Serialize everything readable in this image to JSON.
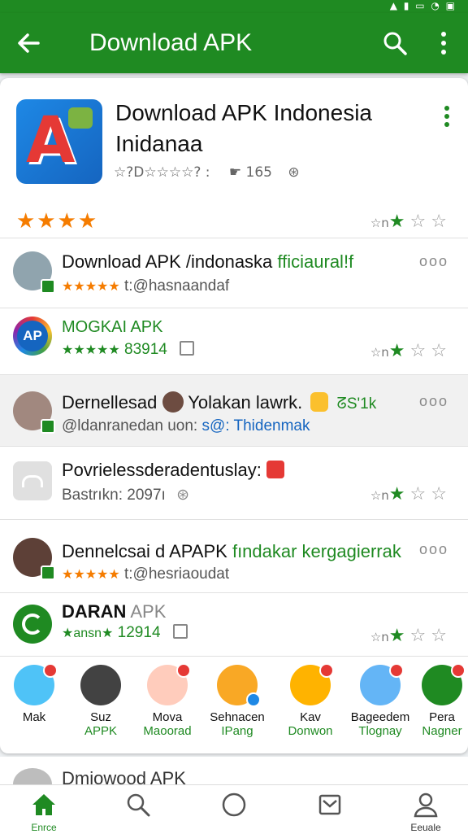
{
  "statusbar": {
    "icons": "▲ ▮ ▭ ◔ ▣"
  },
  "appbar": {
    "title": "Download APK"
  },
  "app": {
    "title": "Download APK Indonesia Inidanaa",
    "meta": "☆?D☆☆☆☆? :",
    "count": "165",
    "stars": "★★★★",
    "rate_label": "☆n"
  },
  "rows": [
    {
      "title": "Download APK /indonaska",
      "title_tag": "fficiaural!f",
      "stars": "★★★★★",
      "sub": "t:@hasnaandaf",
      "more": "ooo"
    },
    {
      "title": "MOGKAI APK",
      "stars": "★★★★★",
      "sub": "83914",
      "rate_label": "☆n",
      "avatar_text": "AP"
    },
    {
      "title": "Dernellesad",
      "title_mid": "Yolakan lawrk.",
      "title_tag": "ᘔS'1k",
      "sub_a": "@ldanranedan uon:",
      "sub_b": "s@: Thidenmak",
      "more": "ooo"
    },
    {
      "title": "Povrielessderadentuslay:",
      "sub": "Bastrıkn: 2097ı",
      "rate_label": "☆n"
    },
    {
      "title": "Dennelcsai d APAPK",
      "title_tag": "fındakar kergagierrak",
      "stars": "★★★★★",
      "sub": "t:@hesriaoudat",
      "more": "ooo"
    },
    {
      "title_bold": "DARAN",
      "title_rest": "APK",
      "stars": "★ansn★",
      "sub": "12914",
      "rate_label": "☆n"
    }
  ],
  "stories": [
    {
      "name": "Mak",
      "sub": ""
    },
    {
      "name": "Suz",
      "sub": "APPK"
    },
    {
      "name": "Mova",
      "sub": "Maoorad"
    },
    {
      "name": "Sehnacen",
      "sub": "IPang"
    },
    {
      "name": "Kav",
      "sub": "Donwon"
    },
    {
      "name": "Bageedem",
      "sub": "Tlognay"
    },
    {
      "name": "Pera",
      "sub": "Nagner"
    }
  ],
  "peek": {
    "title": "Dmiowood APK"
  },
  "nav": {
    "home": "Enrce",
    "profile": "Eeuale"
  },
  "colors": {
    "primary": "#1f8a22",
    "star": "#f57c00",
    "accent_red": "#e53935"
  }
}
